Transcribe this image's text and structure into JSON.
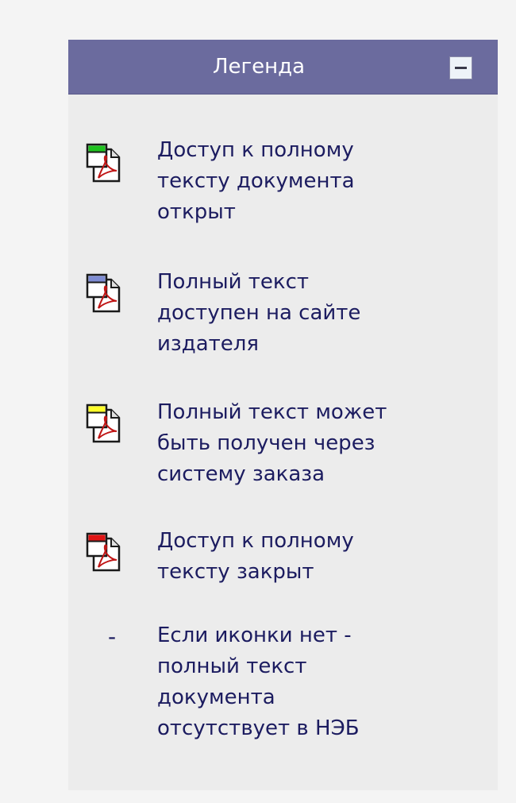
{
  "legend": {
    "title": "Легенда",
    "collapse_icon": "minus-icon",
    "items": [
      {
        "icon": "pdf-icon",
        "status_color": "#1fc21f",
        "text_lines": [
          "Доступ к полному",
          "тексту документа",
          "открыт"
        ]
      },
      {
        "icon": "pdf-icon",
        "status_color": "#7e8cd3",
        "text_lines": [
          "Полный текст",
          "доступен на сайте",
          "издателя"
        ]
      },
      {
        "icon": "pdf-icon",
        "status_color": "#ffff2a",
        "text_lines": [
          "Полный текст может",
          "быть получен через",
          "систему заказа"
        ]
      },
      {
        "icon": "pdf-icon",
        "status_color": "#e01515",
        "text_lines": [
          "Доступ к полному",
          "тексту закрыт"
        ]
      },
      {
        "icon": "dash",
        "marker": "-",
        "text_lines": [
          "Если иконки нет -",
          "полный текст",
          "документа",
          "отсутствует в НЭБ"
        ]
      }
    ]
  },
  "colors": {
    "header_bg": "#6b6b9e",
    "panel_bg": "#ececec",
    "page_bg": "#f4f4f4",
    "text": "#1c1c60",
    "pdf_symbol": "#c01515"
  }
}
